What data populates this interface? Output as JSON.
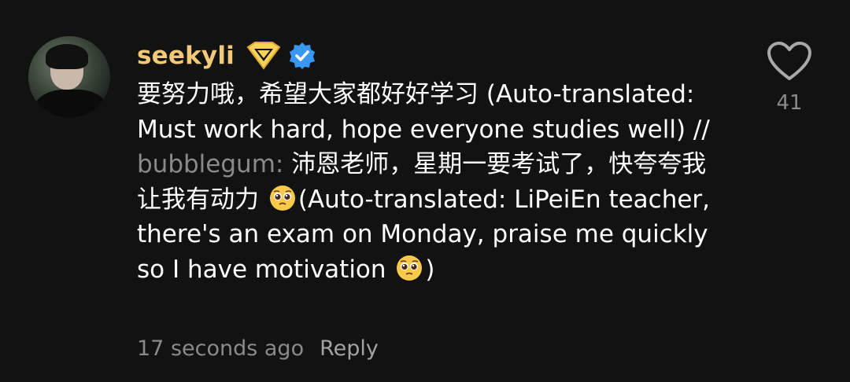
{
  "comment": {
    "username": "seekyli",
    "text_part1": "要努力哦，希望大家都好好学习 (Auto-translated: Must work hard, hope everyone studies well) // ",
    "mention": "bubblegum:",
    "text_part2": " 沛恩老师，星期一要考试了，快夸夸我让我有动力 ",
    "text_part3": "(Auto-translated: LiPeiEn teacher, there's an exam on Monday, praise me quickly so I have motivation ",
    "text_part4": ")",
    "timestamp": "17 seconds ago",
    "reply_label": "Reply",
    "like_count": "41"
  },
  "icons": {
    "gem_badge": "gem-badge-icon",
    "verified_badge": "verified-badge-icon",
    "heart": "heart-outline-icon",
    "pleading_emoji": "pleading-face-emoji"
  },
  "colors": {
    "background": "#121212",
    "username": "#f2c879",
    "text": "#ffffff",
    "secondary": "#8a8a8a",
    "verified": "#3897f0"
  }
}
